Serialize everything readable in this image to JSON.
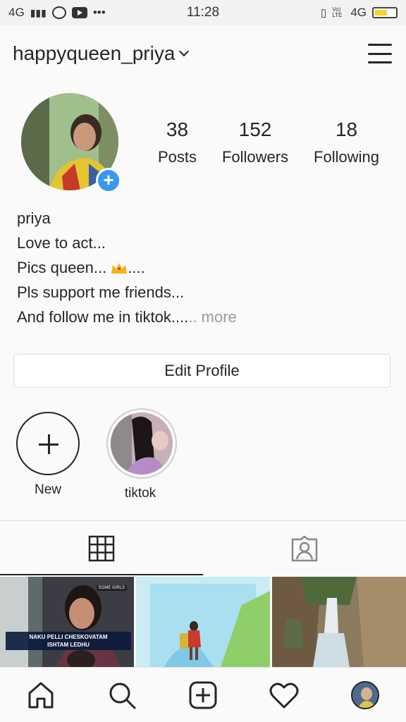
{
  "status_bar": {
    "network": "4G",
    "time": "11:28",
    "network_right": "4G",
    "volte": "Vo) LTE",
    "battery_level": 0.6
  },
  "header": {
    "username": "happyqueen_priya"
  },
  "profile": {
    "stats": [
      {
        "value": "38",
        "label": "Posts"
      },
      {
        "value": "152",
        "label": "Followers"
      },
      {
        "value": "18",
        "label": "Following"
      }
    ],
    "bio": {
      "name": "priya",
      "line1": "Love to act...",
      "line2": "Pics queen... ",
      "line2_suffix": "....",
      "line3": "Pls support me friends...",
      "line4": "And follow me in tiktok....",
      "more": ".. more"
    },
    "edit_button": "Edit Profile"
  },
  "highlights": [
    {
      "label": "New"
    },
    {
      "label": "tiktok"
    }
  ],
  "grid": {
    "post1_sticker": "SOME GIRLS",
    "post1_caption_line1": "NAKU PELLI CHESKOVATAM",
    "post1_caption_line2": "ISHTAM LEDHU"
  },
  "colors": {
    "accent": "#3897f0",
    "text": "#262626",
    "border": "#dbdbdb"
  },
  "icons": {
    "tab_grid": "grid-icon",
    "tab_tagged": "tagged-icon",
    "nav": [
      "home-icon",
      "search-icon",
      "add-post-icon",
      "heart-icon",
      "profile-avatar"
    ]
  }
}
